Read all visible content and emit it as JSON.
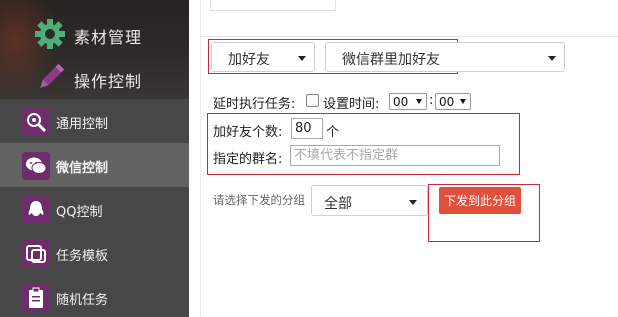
{
  "sidebar": {
    "top_items": [
      {
        "label": "素材管理",
        "icon": "gear-icon"
      },
      {
        "label": "操作控制",
        "icon": "pen-icon"
      }
    ],
    "items": [
      {
        "label": "通用控制",
        "icon": "settings-icon"
      },
      {
        "label": "微信控制",
        "icon": "wechat-icon"
      },
      {
        "label": "QQ控制",
        "icon": "qq-icon"
      },
      {
        "label": "任务模板",
        "icon": "template-icon"
      },
      {
        "label": "随机任务",
        "icon": "clipboard-icon"
      }
    ],
    "active_item": "微信控制"
  },
  "form": {
    "action_select": "加好友",
    "action_subselect": "微信群里加好友",
    "delay_label": "延时执行任务:",
    "set_time_label": "设置时间:",
    "hour": "00",
    "minute": "00",
    "count_label": "加好友个数:",
    "count_value": "80",
    "count_unit": "个",
    "group_label": "指定的群名:",
    "group_placeholder": "不填代表不指定群",
    "dispatch_label": "请选择下发的分组",
    "dispatch_select": "全部",
    "dispatch_button": "下发到此分组"
  },
  "colors": {
    "sidebar_bg": "#474747",
    "sidebar_active": "#636363",
    "icon_bg": "#6d2d6b",
    "icon_green": "#4caf7a",
    "highlight_red": "#d0243a",
    "button_red": "#e0503a"
  }
}
